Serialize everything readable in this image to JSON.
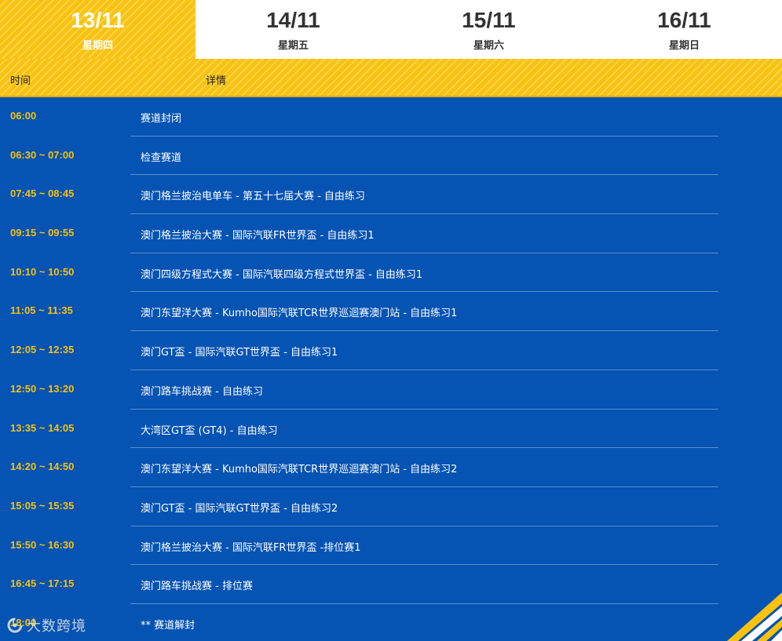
{
  "tabs": [
    {
      "date": "13/11",
      "day": "星期四",
      "active": true
    },
    {
      "date": "14/11",
      "day": "星期五",
      "active": false
    },
    {
      "date": "15/11",
      "day": "星期六",
      "active": false
    },
    {
      "date": "16/11",
      "day": "星期日",
      "active": false
    }
  ],
  "header": {
    "time_label": "时间",
    "detail_label": "详情"
  },
  "schedule": [
    {
      "time": "06:00",
      "detail": "赛道封闭"
    },
    {
      "time": "06:30 ~ 07:00",
      "detail": "检查赛道"
    },
    {
      "time": "07:45 ~ 08:45",
      "detail": "澳门格兰披治电单车 - 第五十七届大赛 - 自由练习"
    },
    {
      "time": "09:15 ~ 09:55",
      "detail": "澳门格兰披治大赛 - 国际汽联FR世界盃 - 自由练习1"
    },
    {
      "time": "10:10 ~ 10:50",
      "detail": "澳门四级方程式大赛 - 国际汽联四级方程式世界盃 - 自由练习1"
    },
    {
      "time": "11:05 ~ 11:35",
      "detail": "澳门东望洋大赛 - Kumho国际汽联TCR世界巡迴赛澳门站 - 自由练习1"
    },
    {
      "time": "12:05 ~ 12:35",
      "detail": "澳门GT盃 - 国际汽联GT世界盃 - 自由练习1"
    },
    {
      "time": "12:50 ~ 13:20",
      "detail": "澳门路车挑战赛 - 自由练习"
    },
    {
      "time": "13:35 ~ 14:05",
      "detail": "大湾区GT盃 (GT4) - 自由练习"
    },
    {
      "time": "14:20 ~ 14:50",
      "detail": "澳门东望洋大赛 - Kumho国际汽联TCR世界巡迴赛澳门站 - 自由练习2"
    },
    {
      "time": "15:05 ~ 15:35",
      "detail": "澳门GT盃 - 国际汽联GT世界盃 - 自由练习2"
    },
    {
      "time": "15:50 ~ 16:30",
      "detail": "澳门格兰披治大赛 - 国际汽联FR世界盃 -排位赛1"
    },
    {
      "time": "16:45 ~ 17:15",
      "detail": "澳门路车挑战赛 - 排位赛"
    },
    {
      "time": "18:00",
      "detail": "** 赛道解封"
    }
  ],
  "watermark": {
    "text": "大数跨境",
    "icon": "brand-logo-icon"
  },
  "colors": {
    "primary_blue": "#0553b3",
    "accent_yellow": "#f8c20f"
  }
}
